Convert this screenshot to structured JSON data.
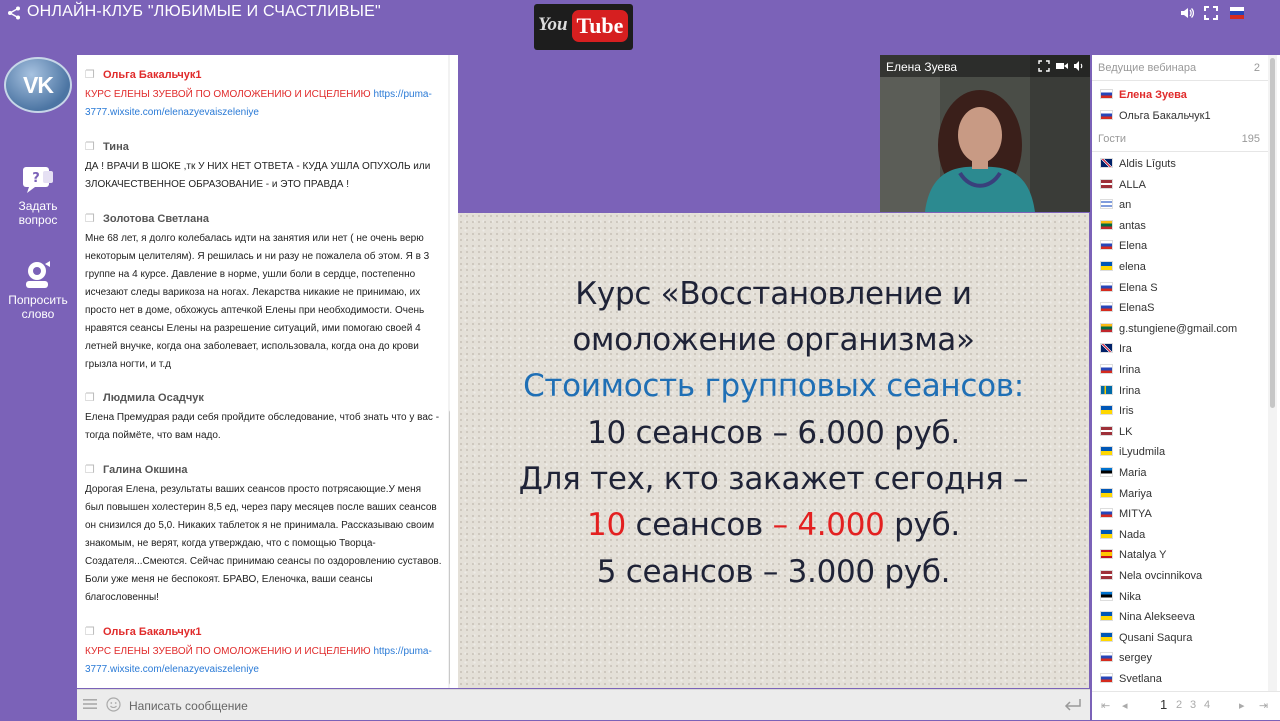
{
  "header": {
    "title": "ОНЛАЙН-КЛУБ \"ЛЮБИМЫЕ И СЧАСТЛИВЫЕ\"",
    "youtube_you": "You",
    "youtube_tube": "Tube"
  },
  "sidebar": {
    "vk_logo": "VK",
    "ask_question": "Задать вопрос",
    "ask_question_line1": "Задать",
    "ask_question_line2": "вопрос",
    "request_word_line1": "Попросить",
    "request_word_line2": "слово"
  },
  "chat": {
    "messages": [
      {
        "author": "Ольга Бакальчук1",
        "text": "КУРС ЕЛЕНЫ ЗУЕВОЙ ПО ОМОЛОЖЕНИЮ И ИСЦЕЛЕНИЮ",
        "link_a": "https://puma-",
        "link_b": "3777.wixsite.com/elenazyevaiszeleniye"
      },
      {
        "author": "Тина",
        "line1": "ДА ! ВРАЧИ В ШОКЕ ,тк У НИХ НЕТ ОТВЕТА - КУДА УШЛА ОПУХОЛЬ или",
        "line2": "ЗЛОКАЧЕСТВЕННОЕ ОБРАЗОВАНИЕ - и ЭТО ПРАВДА !"
      },
      {
        "author": "Золотова Светлана",
        "lines": [
          "Мне 68 лет, я долго колебалась идти на занятия или нет ( не очень верю",
          "некоторым целителям). Я решилась и ни разу не пожалела об этом. Я в 3",
          "группе на 4 курсе. Давление в норме, ушли боли в сердце, постепенно",
          "исчезают следы варикоза на ногах. Лекарства никакие не принимаю, их",
          "просто нет в доме, обхожусь аптечкой Елены при необходимости. Очень",
          "нравятся сеансы Елены на разрешение ситуаций, ими помогаю своей 4",
          "летней внучке, когда она заболевает, использовала, когда она до крови",
          "грызла ногти, и т.д"
        ]
      },
      {
        "author": "Людмила Осадчук",
        "line1": "Елена Премудрая ради себя пройдите обследование, чтоб знать что у вас -",
        "line2": "тогда поймёте, что вам надо."
      },
      {
        "author": "Галина Окшина",
        "lines": [
          "Дорогая Елена, результаты ваших сеансов просто потрясающие.У меня",
          "был повышен холестерин 8,5 ед, через пару месяцев после ваших сеансов",
          "он снизился до 5,0. Никаких таблеток я не принимала. Рассказываю своим",
          "знакомым, не верят, когда утверждаю, что с помощью Творца-",
          "Создателя...Смеются. Сейчас принимаю сеансы по оздоровлению суставов.",
          "Боли уже меня не беспокоят. БРАВО, Еленочка, ваши сеансы",
          "благословенны!"
        ]
      },
      {
        "author": "Ольга Бакальчук1",
        "text": "КУРС ЕЛЕНЫ ЗУЕВОЙ ПО ОМОЛОЖЕНИЮ И ИСЦЕЛЕНИЮ",
        "link_a": "https://puma-",
        "link_b": "3777.wixsite.com/elenazyevaiszeleniye"
      }
    ],
    "input_placeholder": "Написать сообщение"
  },
  "video": {
    "name": "Елена Зуева"
  },
  "slide": {
    "line1": "Курс «Восстановление и",
    "line2": "омоложение организма»",
    "line3": "Стоимость групповых сеансов:",
    "line4": "10 сеансов – 6.000 руб.",
    "line5": "Для тех, кто закажет сегодня –",
    "line6_a": "10",
    "line6_b": " сеансов ",
    "line6_c": "– 4.000",
    "line6_d": " руб.",
    "line7": "5 сеансов – 3.000 руб."
  },
  "participants": {
    "hosts_label": "Ведущие вебинара",
    "hosts_count": "2",
    "hosts": [
      "Елена Зуева",
      "Ольга Бакальчук1"
    ],
    "guests_label": "Гости",
    "guests_count": "195",
    "guests": [
      {
        "name": "Aldis Līguts",
        "flag": "gb"
      },
      {
        "name": "ALLA",
        "flag": "lv"
      },
      {
        "name": "an",
        "flag": "il"
      },
      {
        "name": "antas",
        "flag": "lt"
      },
      {
        "name": "Elena",
        "flag": "ru"
      },
      {
        "name": "elena",
        "flag": "ua"
      },
      {
        "name": "Elena S",
        "flag": "ru"
      },
      {
        "name": "ElenaS",
        "flag": "ru"
      },
      {
        "name": "g.stungiene@gmail.com",
        "flag": "lt"
      },
      {
        "name": "Ira",
        "flag": "gb"
      },
      {
        "name": "Irina",
        "flag": "ru"
      },
      {
        "name": "Irina",
        "flag": "se"
      },
      {
        "name": "Iris",
        "flag": "ua"
      },
      {
        "name": "LK",
        "flag": "lv"
      },
      {
        "name": "iLyudmila",
        "flag": "ua"
      },
      {
        "name": "Maria",
        "flag": "ee"
      },
      {
        "name": "Mariya",
        "flag": "ua"
      },
      {
        "name": "MITYA",
        "flag": "ru"
      },
      {
        "name": "Nada",
        "flag": "ua"
      },
      {
        "name": "Natalya Y",
        "flag": "es"
      },
      {
        "name": "Nela ovcinnikova",
        "flag": "lv"
      },
      {
        "name": "Nika",
        "flag": "ee"
      },
      {
        "name": "Nina Alekseeva",
        "flag": "ua"
      },
      {
        "name": "Qusani Saqura",
        "flag": "ua"
      },
      {
        "name": "sergey",
        "flag": "ru"
      },
      {
        "name": "Svetlana",
        "flag": "ru"
      }
    ],
    "pages": [
      "1",
      "2",
      "3",
      "4"
    ]
  },
  "colors": {
    "background": "#7b62b8",
    "author_red": "#e02b2b",
    "link_blue": "#2a7ad6",
    "slide_blue": "#1f6fb5",
    "slide_red": "#e32020"
  }
}
